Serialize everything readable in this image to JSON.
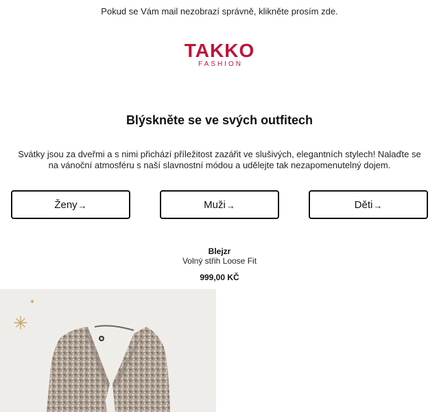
{
  "preheader": {
    "text": "Pokud se Vám mail nezobrazí správně, klikněte prosím zde."
  },
  "logo": {
    "word": "TAKKO",
    "sub": "FASHION",
    "brand_color": "#c0133a"
  },
  "hero": {
    "headline": "Blýskněte se ve svých outfitech",
    "intro": "Svátky jsou za dveřmi a s nimi přichází příležitost zazářit ve slušivých, elegantních stylech! Nalaďte se na vánoční atmosféru s naší slavnostní módou a udělejte tak nezapomenutelný dojem."
  },
  "categories": [
    {
      "label": "Ženy",
      "arrow": "→"
    },
    {
      "label": "Muži",
      "arrow": "→"
    },
    {
      "label": "Děti",
      "arrow": "→"
    }
  ],
  "product": {
    "name": "Blejzr",
    "description": "Volný střih Loose Fit",
    "price": "999,00 KČ",
    "image_icon": "sequin-blazer-image"
  }
}
